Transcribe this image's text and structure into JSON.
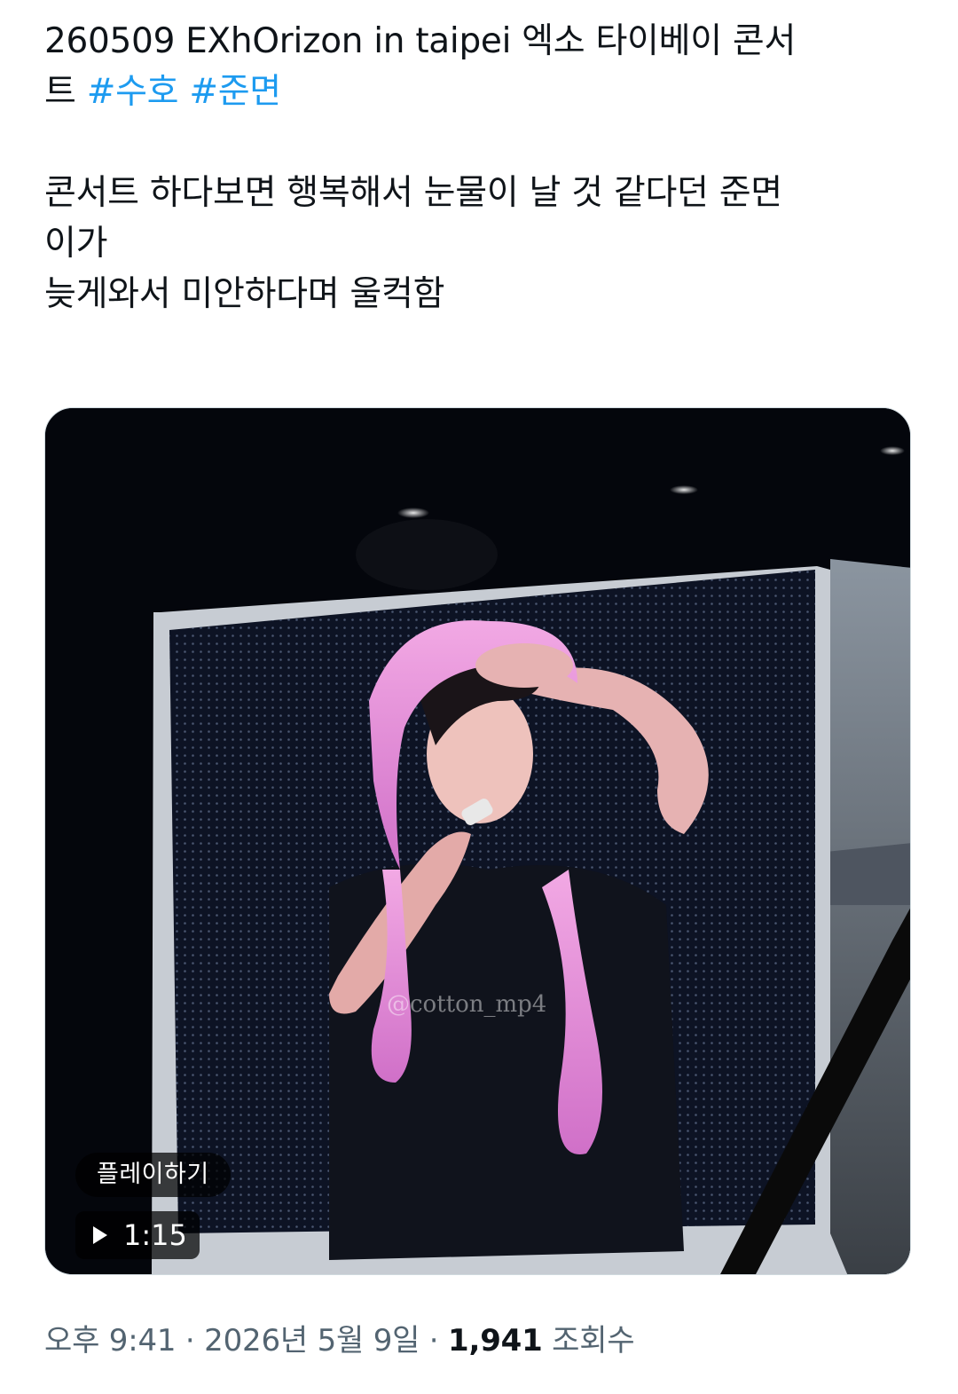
{
  "tweet": {
    "line1": "260509 EXhOrizon in taipei 엑소 타이베이 콘서",
    "line2_prefix": "트 ",
    "hashtag1": "#수호",
    "hashtag2": "#준면",
    "body1": "콘서트 하다보면 행복해서 눈물이 날 것 같다던 준면",
    "body2": "이가",
    "body3": "늦게와서 미안하다며 울컥함"
  },
  "video": {
    "play_label": "플레이하기",
    "duration": "1:15",
    "watermark": "@cotton_mp4"
  },
  "meta": {
    "time": "오후 9:41",
    "sep1": " · ",
    "date": "2026년 5월 9일",
    "sep2": " · ",
    "views_count": "1,941",
    "views_label": " 조회수"
  },
  "colors": {
    "hashtag": "#1d9bf0",
    "meta_text": "#536471",
    "border": "#cfd9de"
  },
  "icons": [
    "play-icon"
  ]
}
